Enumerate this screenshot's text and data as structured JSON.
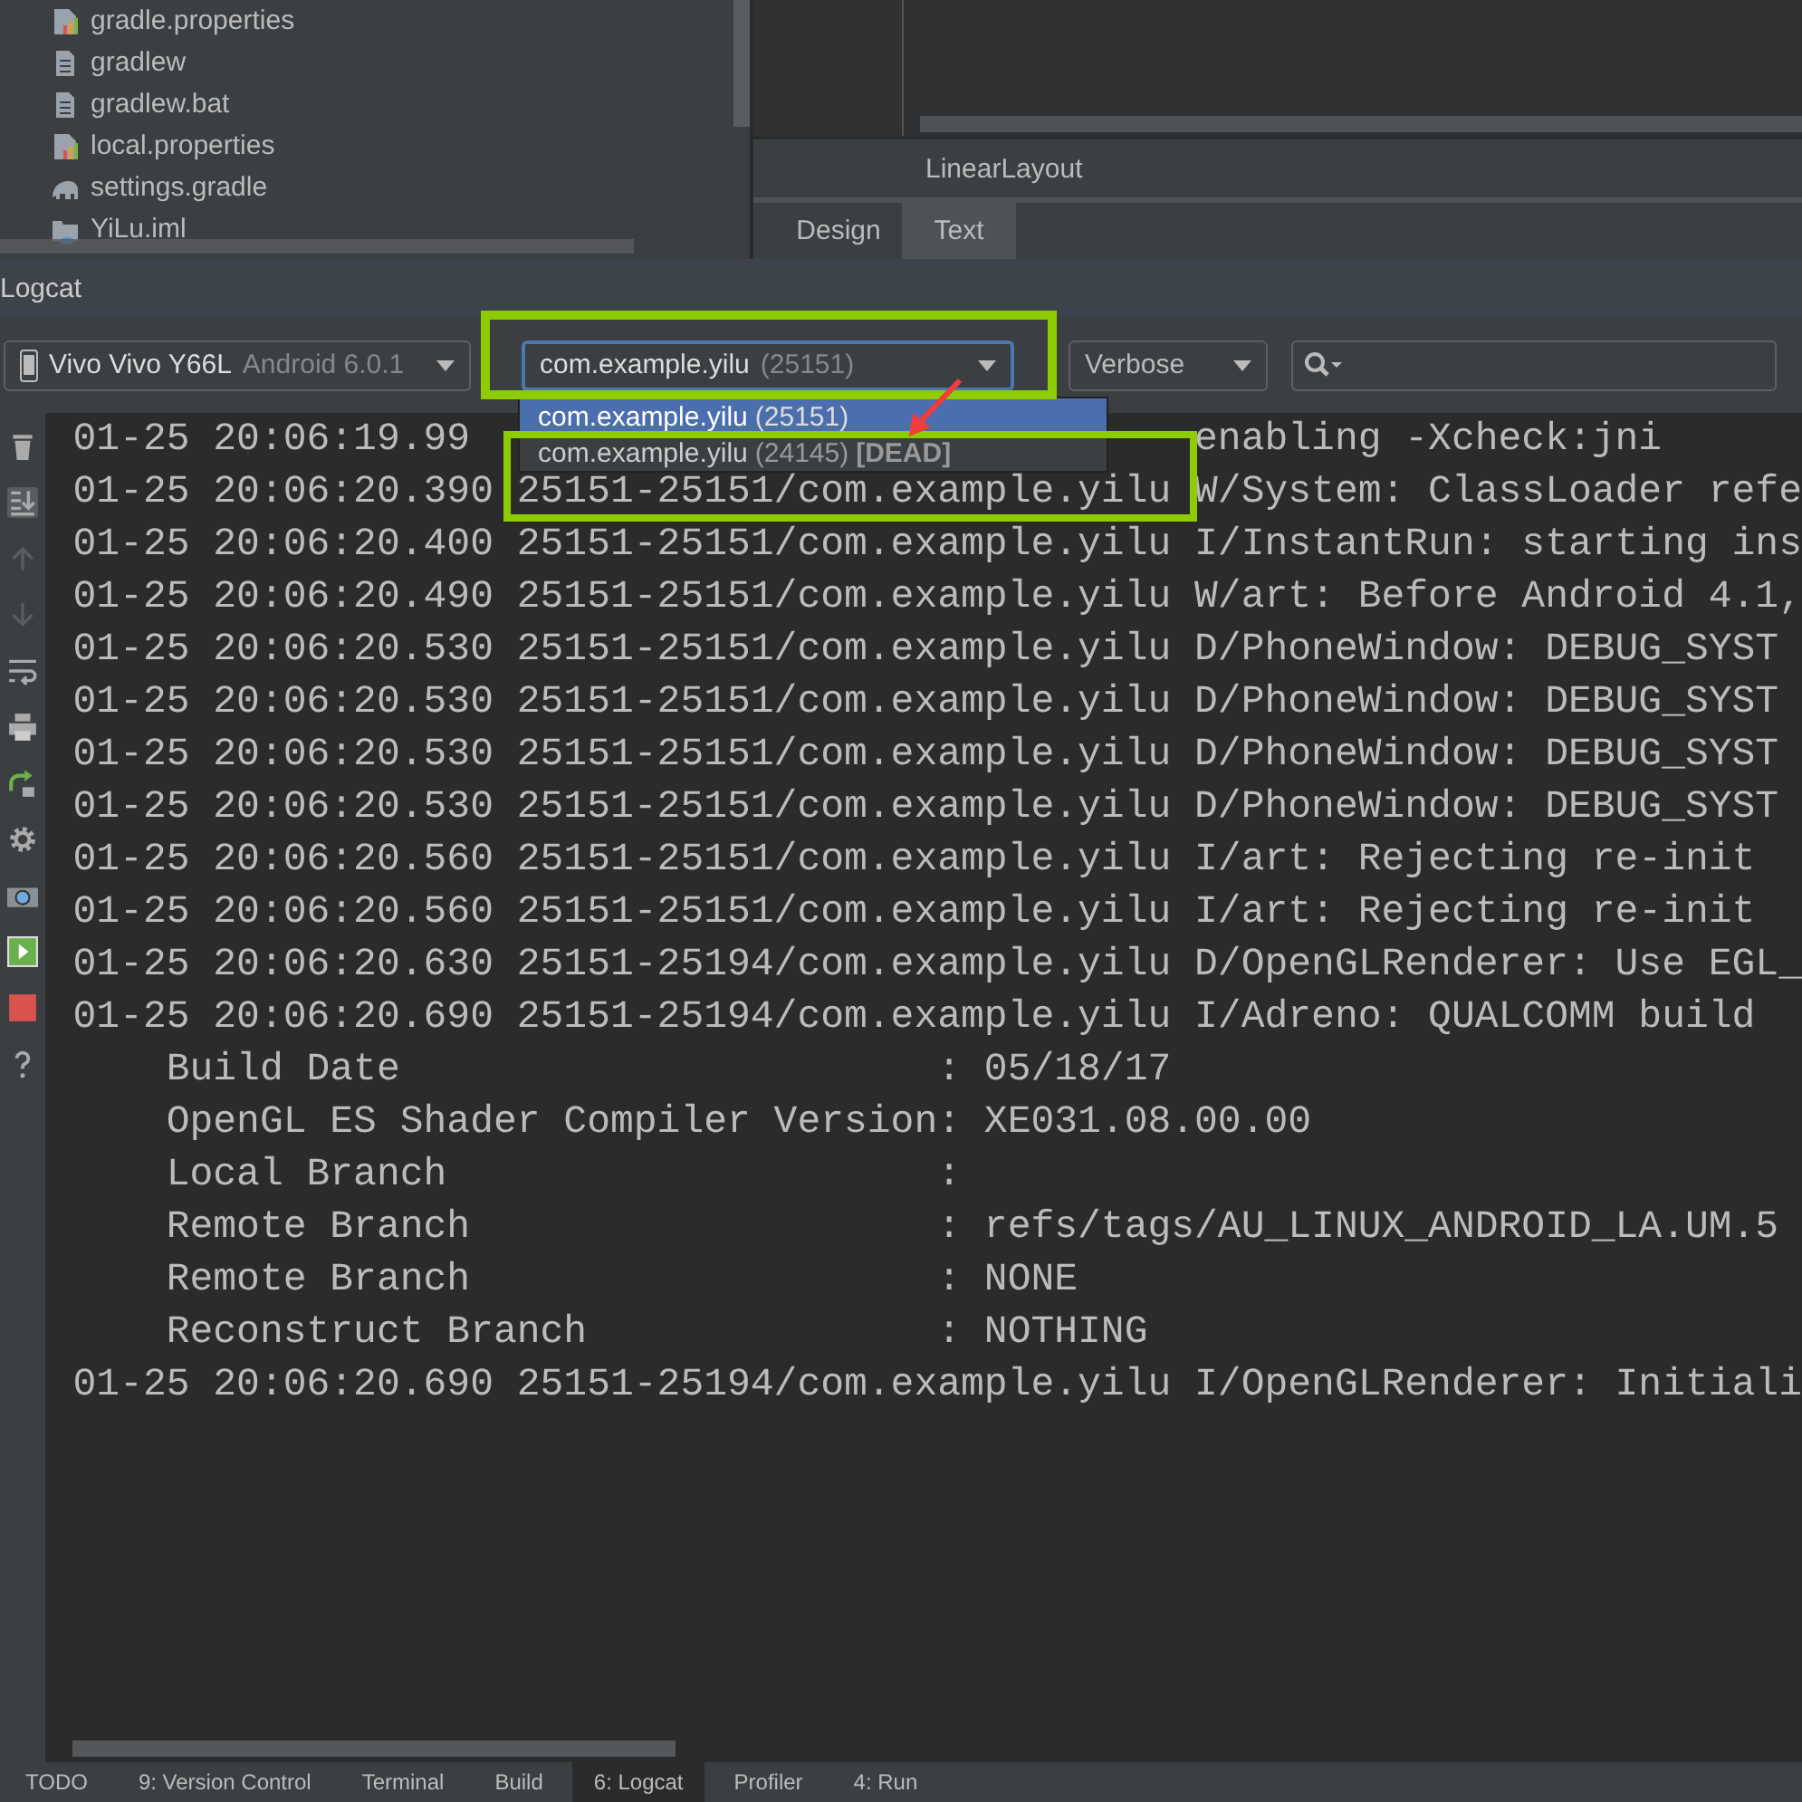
{
  "project_tree": {
    "items": [
      {
        "name": "gradle.properties",
        "kind": "properties"
      },
      {
        "name": "gradlew",
        "kind": "file"
      },
      {
        "name": "gradlew.bat",
        "kind": "file"
      },
      {
        "name": "local.properties",
        "kind": "properties"
      },
      {
        "name": "settings.gradle",
        "kind": "gradle"
      },
      {
        "name": "YiLu.iml",
        "kind": "module"
      }
    ]
  },
  "editor": {
    "breadcrumb": "LinearLayout",
    "tabs": [
      {
        "label": "Design",
        "selected": false
      },
      {
        "label": "Text",
        "selected": true
      }
    ]
  },
  "logcat": {
    "title": "Logcat",
    "device": {
      "name": "Vivo Vivo Y66L",
      "version": "Android 6.0.1"
    },
    "process": {
      "name": "com.example.yilu",
      "pid": "(25151)"
    },
    "process_list": [
      {
        "name": "com.example.yilu",
        "pid": "(25151)",
        "selected": true
      },
      {
        "name": "com.example.yilu",
        "pid": "(24145)",
        "status": "[DEAD]",
        "selected": false
      }
    ],
    "log_level": "Verbose",
    "lines": [
      {
        "text": "01-25 20:06:19.99",
        "tail": "enabling -Xcheck:jni"
      },
      {
        "text": "01-25 20:06:20.390 25151-25151/com.example.yilu W/System: ClassLoader refe"
      },
      {
        "text": "01-25 20:06:20.400 25151-25151/com.example.yilu I/InstantRun: starting ins"
      },
      {
        "text": "01-25 20:06:20.490 25151-25151/com.example.yilu W/art: Before Android 4.1,"
      },
      {
        "text": "01-25 20:06:20.530 25151-25151/com.example.yilu D/PhoneWindow: DEBUG_SYST"
      },
      {
        "text": "01-25 20:06:20.530 25151-25151/com.example.yilu D/PhoneWindow: DEBUG_SYST"
      },
      {
        "text": "01-25 20:06:20.530 25151-25151/com.example.yilu D/PhoneWindow: DEBUG_SYST"
      },
      {
        "text": "01-25 20:06:20.530 25151-25151/com.example.yilu D/PhoneWindow: DEBUG_SYST"
      },
      {
        "text": "01-25 20:06:20.560 25151-25151/com.example.yilu I/art: Rejecting re-init"
      },
      {
        "text": "01-25 20:06:20.560 25151-25151/com.example.yilu I/art: Rejecting re-init"
      },
      {
        "text": "01-25 20:06:20.630 25151-25194/com.example.yilu D/OpenGLRenderer: Use EGL_"
      },
      {
        "text": "01-25 20:06:20.690 25151-25194/com.example.yilu I/Adreno: QUALCOMM build"
      },
      {
        "text": "    Build Date                       : 05/18/17"
      },
      {
        "text": "    OpenGL ES Shader Compiler Version: XE031.08.00.00"
      },
      {
        "text": "    Local Branch                     :"
      },
      {
        "text": "    Remote Branch                    : refs/tags/AU_LINUX_ANDROID_LA.UM.5"
      },
      {
        "text": "    Remote Branch                    : NONE"
      },
      {
        "text": "    Reconstruct Branch               : NOTHING"
      },
      {
        "text": "01-25 20:06:20.690 25151-25194/com.example.yilu I/OpenGLRenderer: Initiali"
      }
    ]
  },
  "bottom_tabs": [
    {
      "label": "TODO",
      "selected": false
    },
    {
      "label": "9: Version Control",
      "selected": false
    },
    {
      "label": "Terminal",
      "selected": false
    },
    {
      "label": "Build",
      "selected": false
    },
    {
      "label": "6: Logcat",
      "selected": true
    },
    {
      "label": "Profiler",
      "selected": false
    },
    {
      "label": "4: Run",
      "selected": false
    }
  ]
}
